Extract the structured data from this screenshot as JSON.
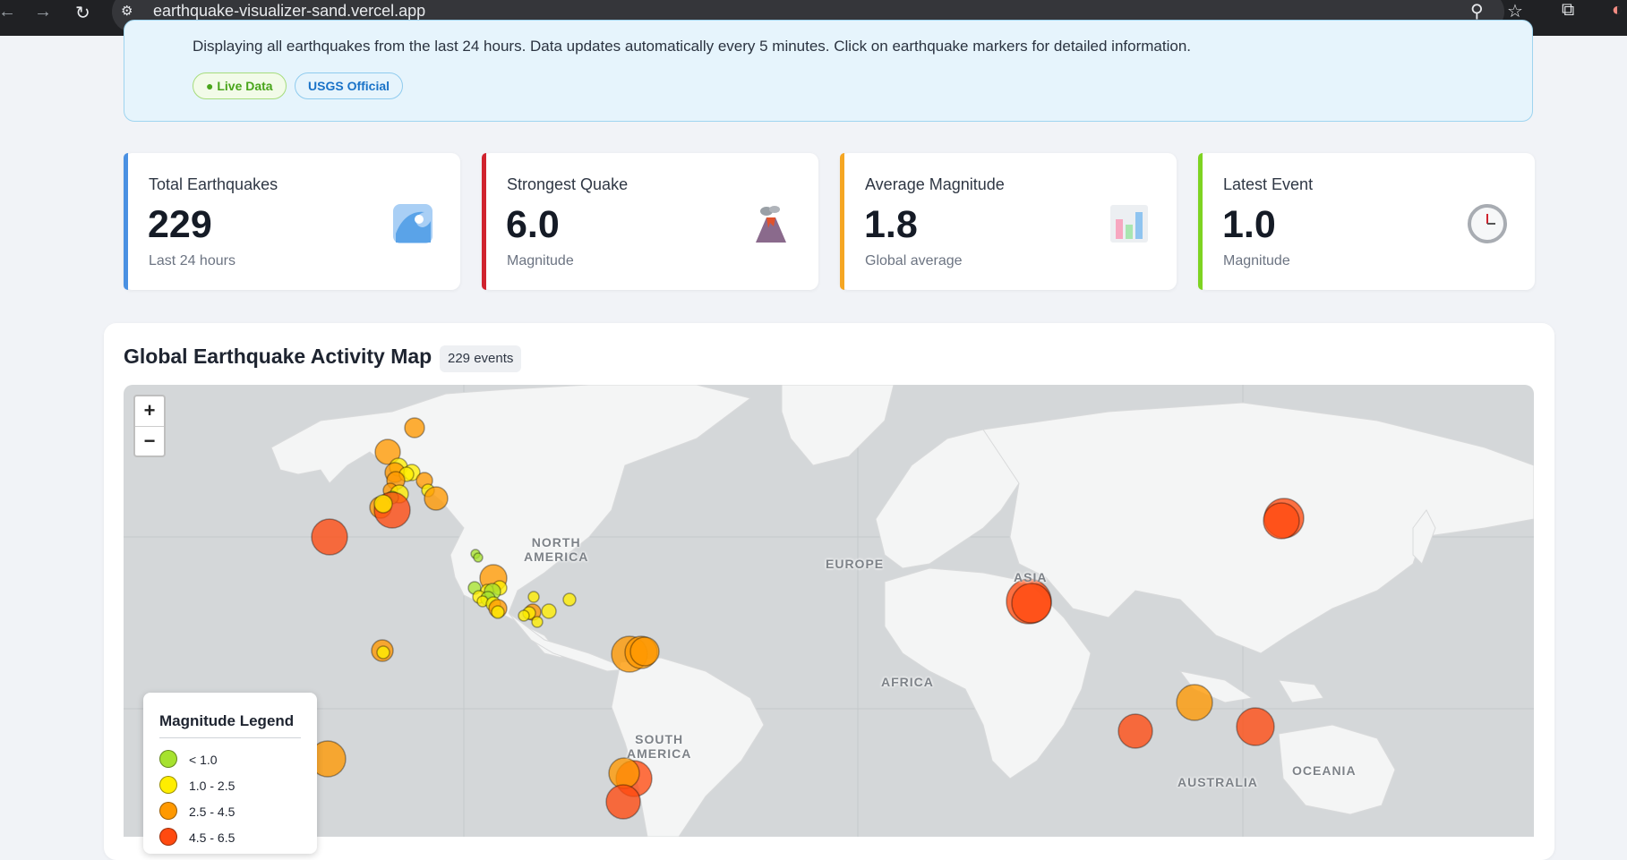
{
  "browser": {
    "url": "earthquake-visualizer-sand.vercel.app"
  },
  "banner": {
    "text": "Displaying all earthquakes from the last 24 hours. Data updates automatically every 5 minutes. Click on earthquake markers for detailed information.",
    "tags": [
      "● Live Data",
      "USGS Official"
    ]
  },
  "stats": [
    {
      "label": "Total Earthquakes",
      "value": "229",
      "sub": "Last 24 hours",
      "accent": "#4a90e2",
      "icon": "wave-icon"
    },
    {
      "label": "Strongest Quake",
      "value": "6.0",
      "sub": "Magnitude",
      "accent": "#d0232e",
      "icon": "volcano-icon"
    },
    {
      "label": "Average Magnitude",
      "value": "1.8",
      "sub": "Global average",
      "accent": "#f5a623",
      "icon": "bar-chart-icon"
    },
    {
      "label": "Latest Event",
      "value": "1.0",
      "sub": "Magnitude",
      "accent": "#7ed321",
      "icon": "clock-icon"
    }
  ],
  "map": {
    "title": "Global Earthquake Activity Map",
    "events_badge": "229 events",
    "zoom_in": "+",
    "zoom_out": "−",
    "region_labels": {
      "north_america": "NORTH\nAMERICA",
      "europe": "EUROPE",
      "asia": "ASIA",
      "africa": "AFRICA",
      "south_america": "SOUTH\nAMERICA",
      "australia": "AUSTRALIA",
      "oceania": "OCEANIA"
    }
  },
  "legend": {
    "title": "Magnitude Legend",
    "items": [
      {
        "label": "< 1.0",
        "color": "#a6e22e"
      },
      {
        "label": "1.0 - 2.5",
        "color": "#ffee00"
      },
      {
        "label": "2.5 - 4.5",
        "color": "#ff9900"
      },
      {
        "label": "4.5 - 6.5",
        "color": "#ff4a10"
      }
    ]
  },
  "colors": {
    "mag_lt1": "#a6e22e",
    "mag_1_25": "#ffee00",
    "mag_25_45": "#ff9900",
    "mag_45_65": "#ff4a10"
  }
}
